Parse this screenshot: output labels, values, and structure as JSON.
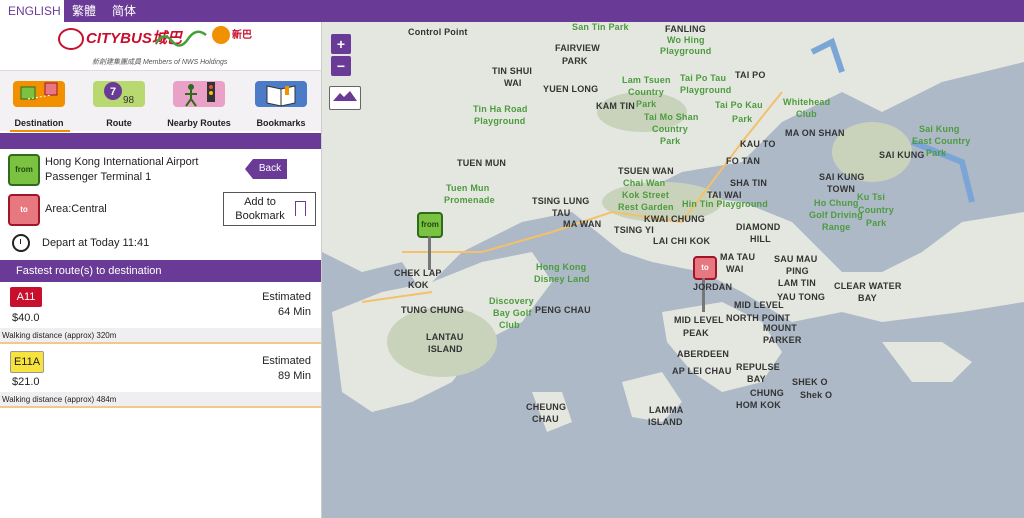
{
  "languages": [
    {
      "label": "ENGLISH",
      "active": true
    },
    {
      "label": "繁體",
      "active": false
    },
    {
      "label": "简体",
      "active": false
    }
  ],
  "logos": {
    "citybus": "CITYBUS城巴",
    "first": "新巴",
    "members": "新創建集團成員 Members of NWS Holdings"
  },
  "tabs": [
    {
      "label": "Destination",
      "active": true
    },
    {
      "label": "Route",
      "active": false
    },
    {
      "label": "Nearby Routes",
      "active": false
    },
    {
      "label": "Bookmarks",
      "active": false
    }
  ],
  "trip": {
    "from_pin": "from",
    "to_pin": "to",
    "from_line1": "Hong Kong International Airport",
    "from_line2": "Passenger Terminal 1",
    "to": "Area:Central",
    "back": "Back",
    "bookmark_line1": "Add to",
    "bookmark_line2": "Bookmark",
    "depart": "Depart at Today 11:41"
  },
  "results": {
    "header": "Fastest route(s) to destination",
    "routes": [
      {
        "route": "A11",
        "fare": "$40.0",
        "est_label": "Estimated",
        "est_time": "64 Min",
        "walk": "Walking distance (approx) 320m",
        "badge_color": "#c8102e"
      },
      {
        "route": "E11A",
        "fare": "$21.0",
        "est_label": "Estimated",
        "est_time": "89 Min",
        "walk": "Walking distance (approx) 484m",
        "badge_color": "#f7e33c"
      }
    ]
  },
  "map": {
    "zoom_in": "+",
    "zoom_out": "−",
    "from_pin": "from",
    "to_pin": "to",
    "labels": {
      "control_point": "Control Point",
      "fanling": "FANLING",
      "wo_hing": "Wo Hing",
      "playground": "Playground",
      "fairview": "FAIRVIEW",
      "park": "PARK",
      "san_tin": "San Tin Park",
      "tin_shui": "TIN SHUI",
      "wai": "WAI",
      "yuen_long": "YUEN LONG",
      "kam_tin": "KAM TIN",
      "lam_tsuen": "Lam Tsuen",
      "country": "Country",
      "park2": "Park",
      "tai_po_tau": "Tai Po Tau",
      "playground2": "Playground",
      "tai_po": "TAI PO",
      "tin_ha": "Tin Ha Road",
      "playground3": "Playground",
      "tai_mo_shan": "Tai Mo Shan",
      "country2": "Country",
      "park3": "Park",
      "tai_po_kau": "Tai Po Kau",
      "park4": "Park",
      "whitehead": "Whitehead",
      "club": "Club",
      "ma_on_shan": "MA ON SHAN",
      "sai_kung": "Sai Kung",
      "east_country": "East Country",
      "park5": "Park",
      "kau_to": "KAU TO",
      "fo_tan": "FO TAN",
      "sai_kung_cap": "SAI KUNG",
      "tuen_mun": "TUEN MUN",
      "tsuen_wan": "TSUEN WAN",
      "chai_wan_kok": "Chai Wan",
      "kok_street": "Kok Street",
      "rest_garden": "Rest Garden",
      "sha_tin": "SHA TIN",
      "tai_wai": "TAI WAI",
      "hin_tin": "Hin Tin Playground",
      "ho_chung": "Ho Chung",
      "golf_driving": "Golf Driving",
      "range": "Range",
      "sai_kung_town": "SAI KUNG",
      "town": "TOWN",
      "tuen_mun_prom": "Tuen Mun",
      "promenade": "Promenade",
      "tsing_lung": "TSING LUNG",
      "tau": "TAU",
      "ma_wan": "MA WAN",
      "kwai_chung": "KWAI CHUNG",
      "tsing_yi": "TSING YI",
      "diamond": "DIAMOND",
      "hill": "HILL",
      "ku_tsi": "Ku Tsi",
      "country3": "Country",
      "park6": "Park",
      "lai_chi_kok": "LAI CHI KOK",
      "chek_lap": "CHEK LAP",
      "kok": "KOK",
      "hk_disney": "Hong Kong",
      "disney_land": "Disney Land",
      "ma_tau": "MA TAU",
      "wai2": "WAI",
      "sau_mau": "SAU MAU",
      "ping": "PING",
      "lam_tin": "LAM TIN",
      "clear_water": "CLEAR WATER",
      "bay": "BAY",
      "jordan": "JORDAN",
      "yau_tong": "YAU TONG",
      "tung_chung": "TUNG CHUNG",
      "discovery": "Discovery",
      "bay_golf": "Bay Golf",
      "club2": "Club",
      "peng_chau": "PENG CHAU",
      "mid_level": "MID LEVEL",
      "north_point": "NORTH POINT",
      "mid_level2": "MID LEVEL",
      "peak": "PEAK",
      "mount": "MOUNT",
      "parker": "PARKER",
      "lantau": "LANTAU",
      "island": "ISLAND",
      "aberdeen": "ABERDEEN",
      "ap_lei_chau": "AP LEI CHAU",
      "repulse": "REPULSE",
      "bay2": "BAY",
      "shek_o": "SHEK O",
      "shek_o2": "Shek O",
      "chung": "CHUNG",
      "hom_kok": "HOM KOK",
      "cheung": "CHEUNG",
      "chau": "CHAU",
      "lamma": "LAMMA",
      "island2": "ISLAND"
    }
  },
  "colors": {
    "brand": "#6a3b96",
    "accent": "#f29100"
  }
}
